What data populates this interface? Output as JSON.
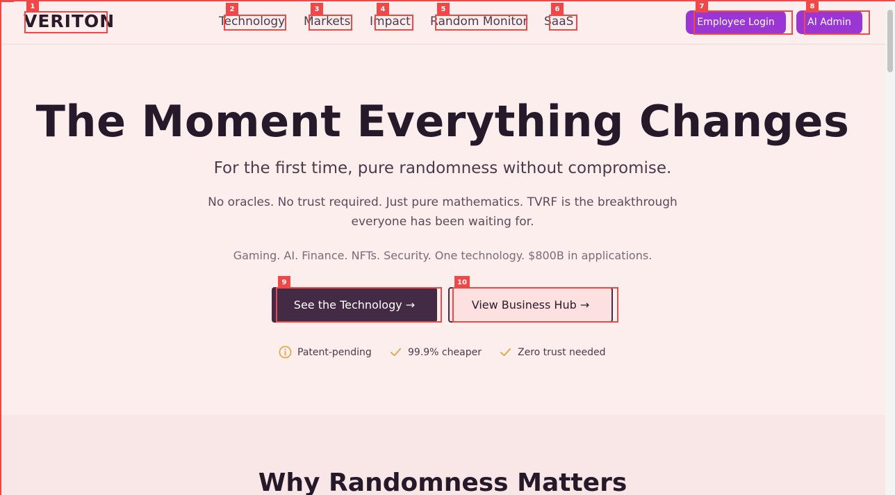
{
  "header": {
    "logo": "VERITON",
    "nav": [
      {
        "label": "Technology",
        "tag": "2"
      },
      {
        "label": "Markets",
        "tag": "3"
      },
      {
        "label": "Impact",
        "tag": "4"
      },
      {
        "label": "Random Monitor",
        "tag": "5"
      },
      {
        "label": "SaaS",
        "tag": "6"
      }
    ],
    "employee_login": "Employee Login",
    "ai_admin": "AI Admin"
  },
  "tags": {
    "logo": "1",
    "employee_login": "7",
    "ai_admin": "8",
    "see_tech": "9",
    "business_hub": "10"
  },
  "hero": {
    "title": "The Moment Everything Changes",
    "subtitle": "For the first time, pure randomness without compromise.",
    "description": "No oracles. No trust required. Just pure mathematics. TVRF is the breakthrough everyone has been waiting for.",
    "tagline": "Gaming. AI. Finance. NFTs. Security. One technology. $800B in applications.",
    "primary_button": "See the Technology →",
    "secondary_button": "View Business Hub →",
    "features": [
      "Patent-pending",
      "99.9% cheaper",
      "Zero trust needed"
    ]
  },
  "section2": {
    "title": "Why Randomness Matters"
  },
  "colors": {
    "accent_purple": "#9b36d4",
    "dark_button": "#432a45",
    "feature_icon": "#e8a030",
    "overlay_red": "#f04848"
  },
  "icons": {
    "feature_0": "info-circle-icon",
    "feature_1": "check-icon",
    "feature_2": "check-icon"
  }
}
